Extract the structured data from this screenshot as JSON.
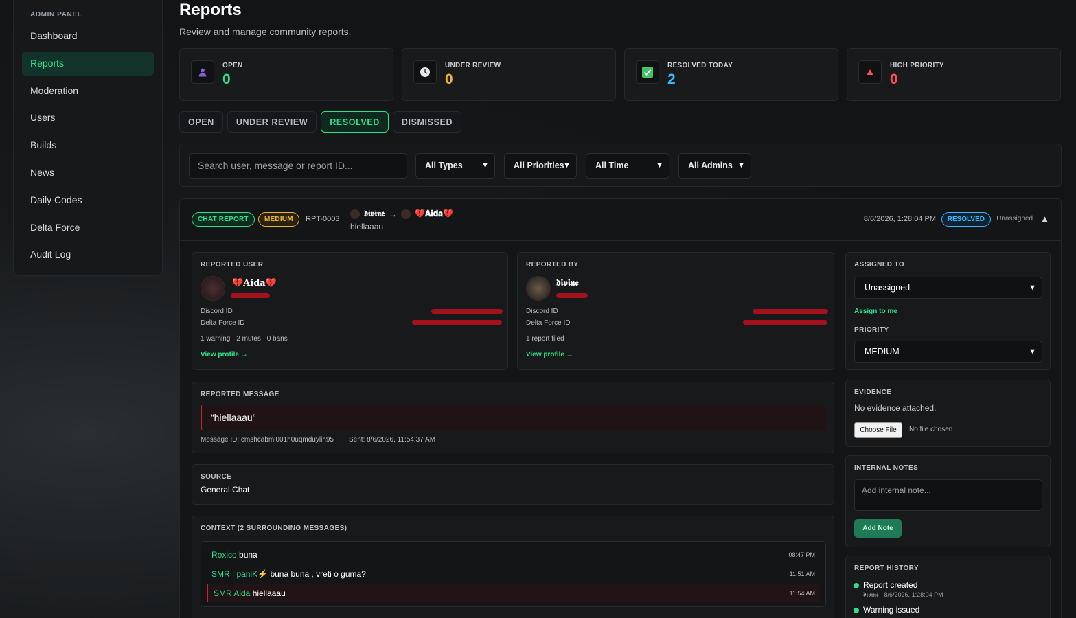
{
  "sidebar": {
    "header": "ADMIN PANEL",
    "items": [
      {
        "label": "Dashboard"
      },
      {
        "label": "Reports",
        "active": true
      },
      {
        "label": "Moderation"
      },
      {
        "label": "Users"
      },
      {
        "label": "Builds"
      },
      {
        "label": "News"
      },
      {
        "label": "Daily Codes"
      },
      {
        "label": "Delta Force"
      },
      {
        "label": "Audit Log"
      }
    ]
  },
  "page": {
    "title": "Reports",
    "subtitle": "Review and manage community reports."
  },
  "stats": [
    {
      "label": "OPEN",
      "value": "0",
      "icon": "person-icon",
      "color": "#2ee08c"
    },
    {
      "label": "UNDER REVIEW",
      "value": "0",
      "icon": "clock-icon",
      "color": "#f0b429"
    },
    {
      "label": "RESOLVED TODAY",
      "value": "2",
      "icon": "check-icon",
      "color": "#38b6ff"
    },
    {
      "label": "HIGH PRIORITY",
      "value": "0",
      "icon": "warning-icon",
      "color": "#ff4d5a"
    }
  ],
  "tabs": [
    "OPEN",
    "UNDER REVIEW",
    "RESOLVED",
    "DISMISSED"
  ],
  "filters": {
    "search_placeholder": "Search user, message or report ID...",
    "types": "All Types",
    "priorities": "All Priorities",
    "time": "All Time",
    "admins": "All Admins"
  },
  "report": {
    "type_badge": "CHAT REPORT",
    "priority_badge": "MEDIUM",
    "id": "RPT-0003",
    "reporter_name": "𝖉𝖎𝖛𝖎𝖓𝖊",
    "arrow": "→",
    "reported_name": "💔𝐀𝐢𝐝𝐚💔",
    "preview": "hiellaaau",
    "date": "8/6/2026, 1:28:04 PM",
    "status_badge": "RESOLVED",
    "assignee": "Unassigned",
    "reported_user": {
      "label": "REPORTED USER",
      "name": "💔𝐀𝐢𝐝𝐚💔",
      "discord_label": "Discord ID",
      "df_label": "Delta Force ID",
      "history": "1 warning · 2 mutes · 0 bans",
      "link": "View profile →"
    },
    "reported_by": {
      "label": "REPORTED BY",
      "name": "𝖉𝖎𝖛𝖎𝖓𝖊",
      "discord_label": "Discord ID",
      "df_label": "Delta Force ID",
      "history": "1 report filed",
      "link": "View profile →"
    },
    "assigned": {
      "label": "ASSIGNED TO",
      "value": "Unassigned",
      "assign_me": "Assign to me",
      "priority_label": "PRIORITY",
      "priority_value": "MEDIUM"
    },
    "message": {
      "label": "REPORTED MESSAGE",
      "text": "“hiellaaau”",
      "message_id": "Message ID: cmshcabml001h0uqmduylih95",
      "sent": "Sent: 8/6/2026, 11:54:37 AM"
    },
    "source": {
      "label": "SOURCE",
      "value": "General Chat"
    },
    "context": {
      "label": "CONTEXT (2 SURROUNDING MESSAGES)",
      "messages": [
        {
          "name": "Roxico",
          "text": "buna",
          "time": "08:47 PM"
        },
        {
          "name": "SMR | paniK⚡",
          "text": "buna buna , vreti o guma?",
          "time": "11:51 AM"
        },
        {
          "name": "SMR Aida",
          "text": "hiellaaau",
          "time": "11:54 AM",
          "highlight": true
        }
      ]
    },
    "evidence": {
      "label": "EVIDENCE",
      "text": "No evidence attached.",
      "choose": "Choose File",
      "none": "No file chosen"
    },
    "notes": {
      "label": "INTERNAL NOTES",
      "placeholder": "Add internal note...",
      "button": "Add Note"
    },
    "history": {
      "label": "REPORT HISTORY",
      "items": [
        {
          "title": "Report created",
          "meta": "𝖉𝖎𝖛𝖎𝖓𝖊 · 8/6/2026, 1:28:04 PM"
        },
        {
          "title": "Warning issued",
          "meta": ""
        }
      ]
    }
  }
}
